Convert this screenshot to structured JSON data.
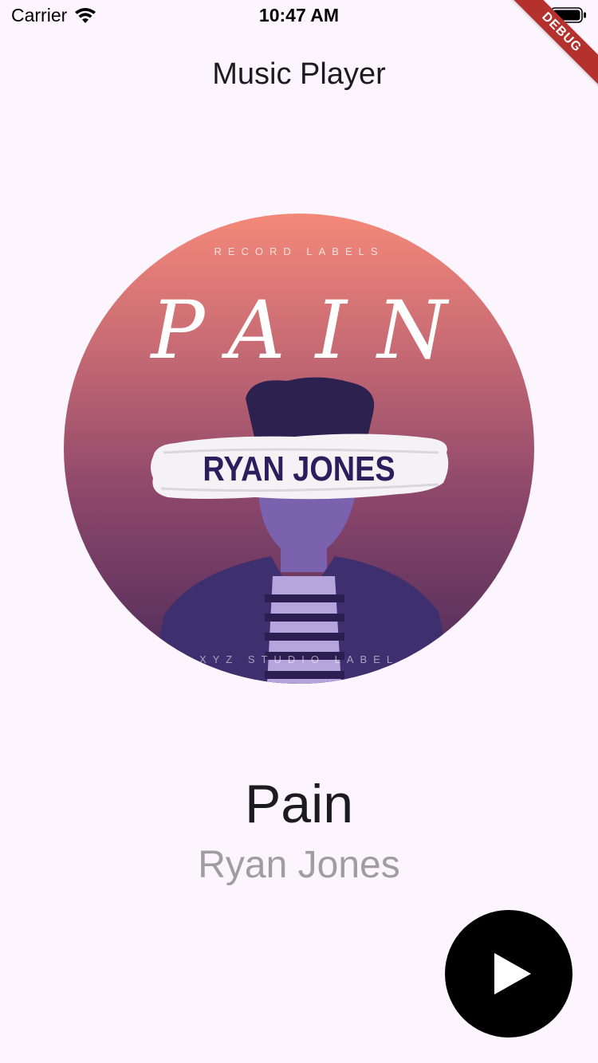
{
  "status_bar": {
    "carrier": "Carrier",
    "time": "10:47 AM",
    "wifi_icon": "wifi-icon",
    "battery_icon": "battery-icon"
  },
  "debug_banner": "DEBUG",
  "app_bar": {
    "title": "Music Player"
  },
  "album_art": {
    "top_label": "RECORD LABELS",
    "title": "PAIN",
    "artist": "RYAN JONES",
    "bottom_label": "XYZ STUDIO LABEL"
  },
  "track": {
    "title": "Pain",
    "artist": "Ryan Jones"
  },
  "controls": {
    "play_icon": "play-icon"
  },
  "colors": {
    "background": "#fcf5fd",
    "fab": "#000000",
    "artist_text": "#9e9e9e",
    "debug_ribbon": "#b5312e"
  }
}
